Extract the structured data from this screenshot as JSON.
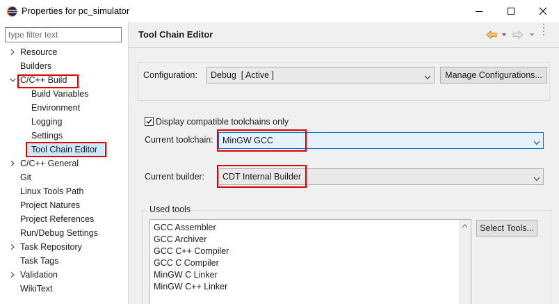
{
  "window": {
    "title": "Properties for pc_simulator",
    "icon": "eclipse-icon",
    "controls": [
      "minimize",
      "maximize",
      "close"
    ]
  },
  "sidebar": {
    "filter_placeholder": "type filter text",
    "items": [
      {
        "label": "Resource",
        "twisty": "collapsed"
      },
      {
        "label": "Builders",
        "twisty": "none"
      },
      {
        "label": "C/C++ Build",
        "twisty": "expanded",
        "highlighted": true
      },
      {
        "label": "Build Variables",
        "twisty": "none"
      },
      {
        "label": "Environment",
        "twisty": "none"
      },
      {
        "label": "Logging",
        "twisty": "none"
      },
      {
        "label": "Settings",
        "twisty": "none"
      },
      {
        "label": "Tool Chain Editor",
        "twisty": "none",
        "selected": true,
        "highlighted": true
      },
      {
        "label": "C/C++ General",
        "twisty": "collapsed"
      },
      {
        "label": "Git",
        "twisty": "none"
      },
      {
        "label": "Linux Tools Path",
        "twisty": "none"
      },
      {
        "label": "Project Natures",
        "twisty": "none"
      },
      {
        "label": "Project References",
        "twisty": "none"
      },
      {
        "label": "Run/Debug Settings",
        "twisty": "none"
      },
      {
        "label": "Task Repository",
        "twisty": "collapsed"
      },
      {
        "label": "Task Tags",
        "twisty": "none"
      },
      {
        "label": "Validation",
        "twisty": "collapsed"
      },
      {
        "label": "WikiText",
        "twisty": "none"
      }
    ]
  },
  "main": {
    "title": "Tool Chain Editor",
    "configuration_label": "Configuration:",
    "configuration_value": "Debug  [ Active ]",
    "manage_configurations_label": "Manage Configurations...",
    "display_compatible_label": "Display compatible toolchains only",
    "display_compatible_checked": true,
    "current_toolchain_label": "Current toolchain:",
    "current_toolchain_value": "MinGW GCC",
    "current_builder_label": "Current builder:",
    "current_builder_value": "CDT Internal Builder",
    "used_tools_label": "Used tools",
    "used_tools": [
      "GCC Assembler",
      "GCC Archiver",
      "GCC C++ Compiler",
      "GCC C Compiler",
      "MinGW C Linker",
      "MinGW C++ Linker"
    ],
    "select_tools_label": "Select Tools..."
  },
  "colors": {
    "highlight_border": "#e00000",
    "selection_bg": "#cce8ff",
    "toolchain_combo_bg": "#e5f1fb",
    "toolchain_combo_border": "#0078d7",
    "back_arrow": "#f0a830"
  }
}
